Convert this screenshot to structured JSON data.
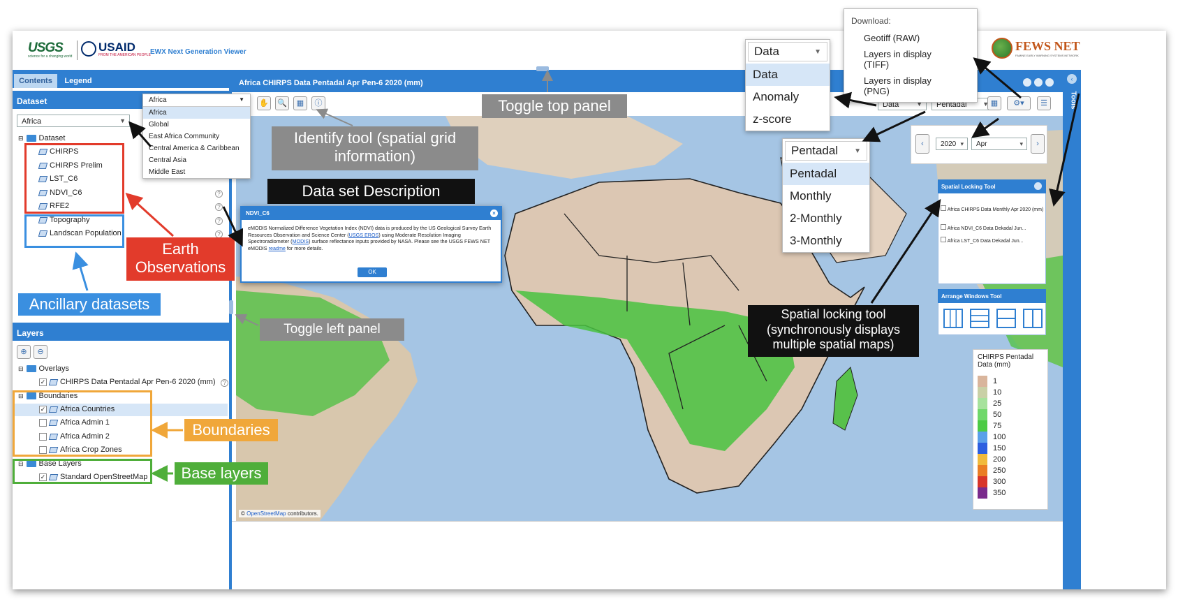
{
  "header": {
    "usgs": "USGS",
    "usgs_tag": "science for a changing world",
    "usaid": "USAID",
    "usaid_tag": "FROM THE AMERICAN PEOPLE",
    "app_title": "EWX Next Generation Viewer",
    "fews": "FEWS NET",
    "fews_tag": "FAMINE EARLY WARNING SYSTEMS NETWORK"
  },
  "left_tabs": [
    "Contents",
    "Legend"
  ],
  "dataset": {
    "panel_title": "Dataset",
    "region_value": "Africa",
    "region_options": [
      "Africa",
      "Global",
      "East Africa Community",
      "Central America & Caribbean",
      "Central Asia",
      "Middle East"
    ],
    "root": "Dataset",
    "items": [
      "CHIRPS",
      "CHIRPS Prelim",
      "LST_C6",
      "NDVI_C6",
      "RFE2",
      "Topography",
      "Landscan Population"
    ]
  },
  "layers": {
    "panel_title": "Layers",
    "overlays": "Overlays",
    "overlay_item": "CHIRPS Data Pentadal Apr Pen-6 2020 (mm)",
    "boundaries": "Boundaries",
    "boundary_items": [
      "Africa Countries",
      "Africa Admin 1",
      "Africa Admin 2",
      "Africa Crop Zones"
    ],
    "base_layers": "Base Layers",
    "base_item": "Standard OpenStreetMap"
  },
  "map": {
    "title": "Africa CHIRPS Data Pentadal Apr Pen-6 2020 (mm)",
    "attribution_link": "OpenStreetMap",
    "attribution_rest": " contributors.",
    "side_tab": "Tools"
  },
  "toolbar": {
    "data_value": "Data",
    "period_value": "Pentadal",
    "year": "2020",
    "month": "Apr",
    "data_options": [
      "Data",
      "Anomaly",
      "z-score"
    ],
    "period_options": [
      "Pentadal",
      "Monthly",
      "2-Monthly",
      "3-Monthly"
    ]
  },
  "download": {
    "title": "Download:",
    "items": [
      "Geotiff (RAW)",
      "Layers in display (TIFF)",
      "Layers in display (PNG)"
    ]
  },
  "dialog": {
    "title": "NDVI_C6",
    "text1": "eMODIS Normalized Difference Vegetation Index (NDVI) data is produced by the US Geological Survey Earth Resources Observation and Science Center (",
    "link1": "USGS EROS",
    "text2": ") using Moderate Resolution Imaging Spectroradiometer (",
    "link2": "MODIS",
    "text3": ") surface reflectance inputs provided by NASA. Please see the USGS FEWS NET eMODIS ",
    "link3": "readme",
    "text4": " for more details.",
    "ok": "OK"
  },
  "spatial_lock": {
    "title": "Spatial Locking Tool",
    "items": [
      "Africa CHIRPS Data Monthly Apr 2020 (mm)",
      "Africa NDVI_C6 Data Dekadal Jun...",
      "Africa LST_C6 Data Dekadal Jun..."
    ]
  },
  "arrange": {
    "title": "Arrange Windows Tool"
  },
  "legend": {
    "title": "CHIRPS Pentadal Data (mm)",
    "values": [
      "1",
      "10",
      "25",
      "50",
      "75",
      "100",
      "150",
      "200",
      "250",
      "300",
      "350"
    ],
    "colors": [
      "#d9b59c",
      "#c9d0a6",
      "#a6e29c",
      "#6fd86a",
      "#4ccb45",
      "#5aa0ea",
      "#2d5fe0",
      "#f1ba3c",
      "#ea7d24",
      "#d8352a",
      "#7a2a8c"
    ]
  },
  "annotations": {
    "toggle_top": "Toggle top panel",
    "identify": "Identify tool (spatial grid information)",
    "data_desc": "Data set Description",
    "earth_obs": "Earth Observations",
    "ancillary": "Ancillary datasets",
    "toggle_left": "Toggle left panel",
    "spatial_lock": "Spatial locking tool (synchronously displays multiple spatial maps)",
    "boundaries": "Boundaries",
    "base_layers": "Base layers"
  }
}
